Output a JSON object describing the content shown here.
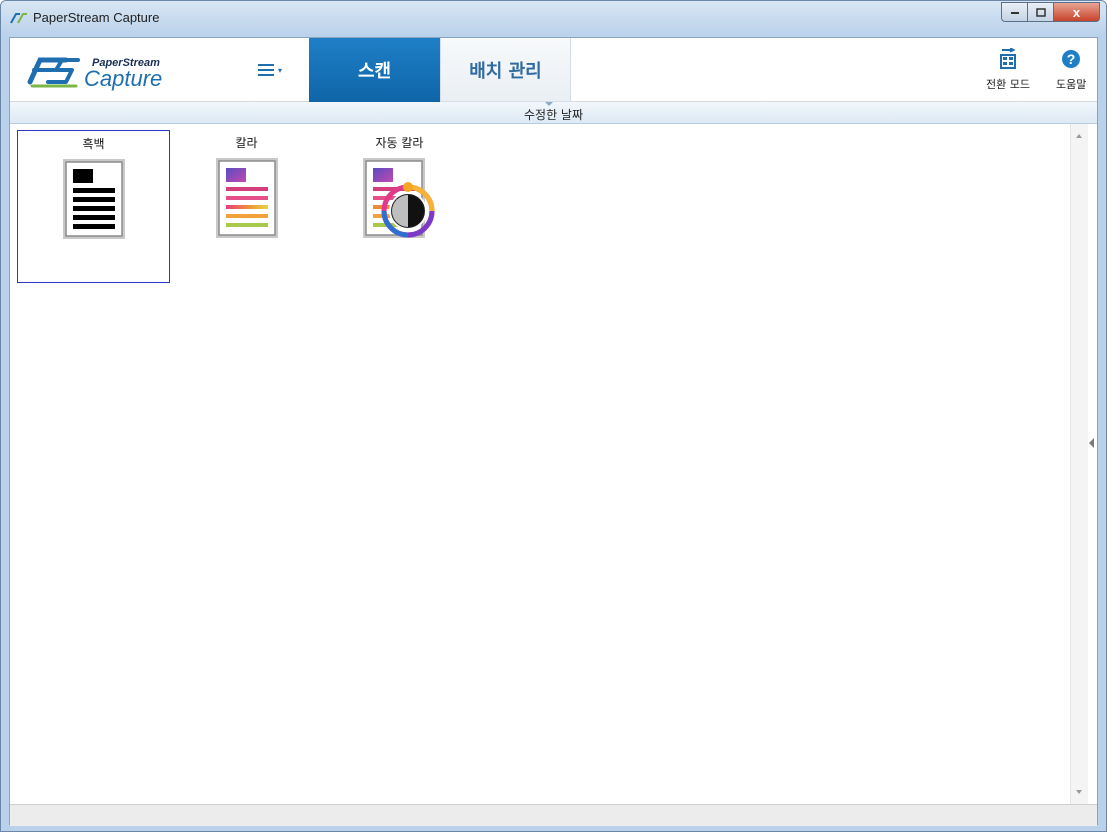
{
  "window": {
    "title": "PaperStream Capture",
    "minimize_icon": "minimize-icon",
    "maximize_icon": "maximize-icon",
    "close_label": "x"
  },
  "toolbar": {
    "logo_top": "PaperStream",
    "logo_bottom": "Capture",
    "menu_icon": "hamburger-menu-icon",
    "tabs": [
      {
        "label": "스캔",
        "active": true
      },
      {
        "label": "배치 관리",
        "active": false
      }
    ],
    "switch_mode_label": "전환 모드",
    "help_label": "도움말"
  },
  "sortbar": {
    "label": "수정한 날짜"
  },
  "profiles": [
    {
      "label": "흑백",
      "icon": "black-white-document-icon",
      "selected": true
    },
    {
      "label": "칼라",
      "icon": "color-document-icon",
      "selected": false
    },
    {
      "label": "자동 칼라",
      "icon": "auto-color-document-icon",
      "selected": false
    }
  ],
  "colors": {
    "active_tab": "#1e7fc6",
    "tab_text": "#2f6aa0",
    "selection_border": "#2a37c6"
  }
}
